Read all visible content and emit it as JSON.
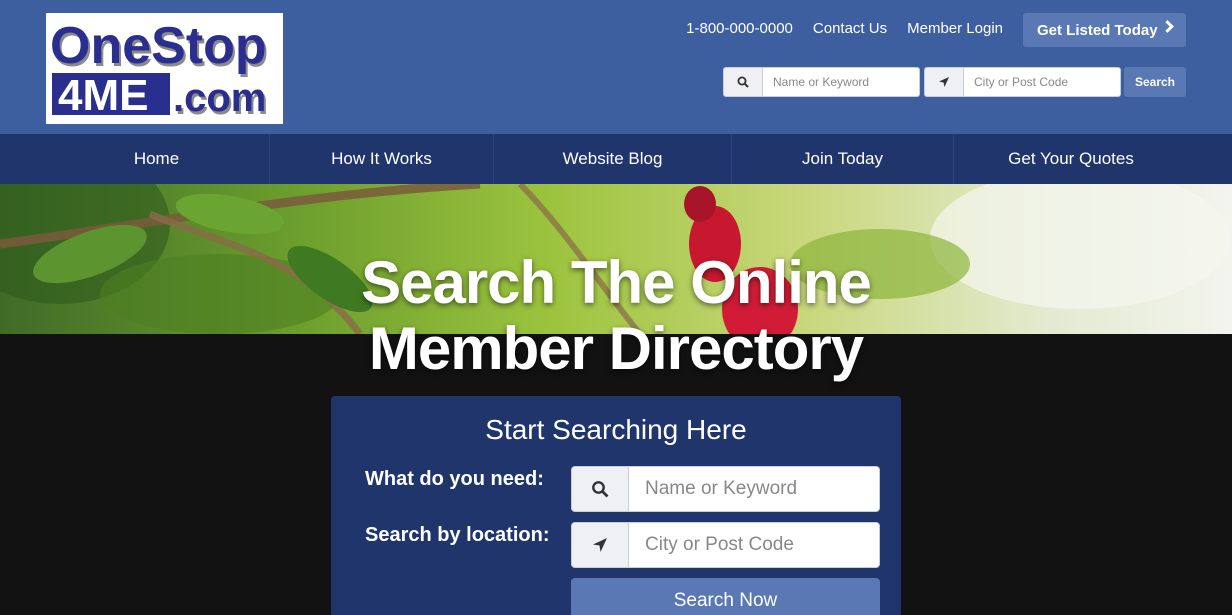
{
  "logo": {
    "line1": "OneStop",
    "line2a": "4ME",
    "line2b": ".com"
  },
  "header": {
    "phone": "1-800-000-0000",
    "contact": "Contact Us",
    "login": "Member Login",
    "cta": "Get Listed Today",
    "mini_search": {
      "keyword_placeholder": "Name or Keyword",
      "location_placeholder": "City or Post Code",
      "button": "Search"
    }
  },
  "nav": {
    "items": [
      {
        "label": "Home"
      },
      {
        "label": "How It Works"
      },
      {
        "label": "Website Blog"
      },
      {
        "label": "Join Today"
      },
      {
        "label": "Get Your Quotes"
      }
    ]
  },
  "hero": {
    "title_line1": "Search The Online",
    "title_line2": "Member Directory"
  },
  "panel": {
    "title": "Start Searching Here",
    "need_label": "What do you need:",
    "need_placeholder": "Name or Keyword",
    "location_label": "Search by location:",
    "location_placeholder": "City or Post Code",
    "button": "Search Now"
  },
  "colors": {
    "header_bg": "#3d5fa0",
    "nav_bg": "#1f356b",
    "accent_button": "#5a78b4",
    "logo_text": "#2a2e8f"
  },
  "icons": [
    "search-icon",
    "location-arrow-icon",
    "chevron-right-icon"
  ]
}
